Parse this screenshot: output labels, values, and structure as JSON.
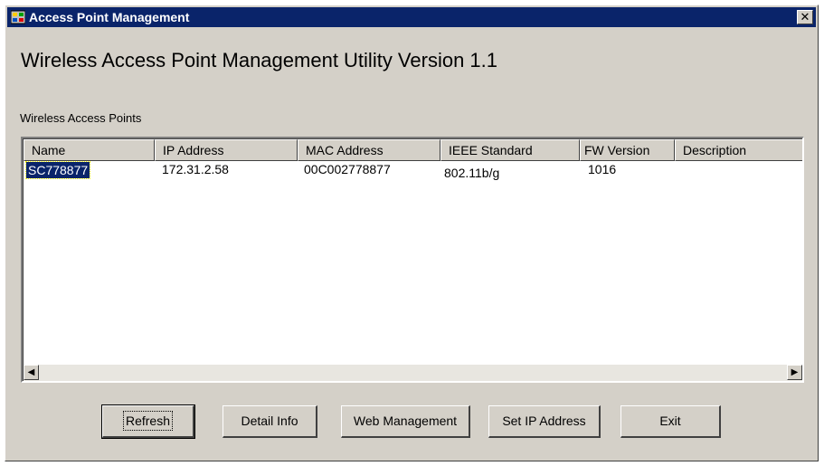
{
  "window": {
    "title": "Access Point Management",
    "close_glyph": "✕"
  },
  "heading": "Wireless Access Point Management Utility Version 1.1",
  "group_label": "Wireless Access Points",
  "table": {
    "columns": [
      "Name",
      "IP Address",
      "MAC Address",
      "IEEE Standard",
      "FW Version",
      "Description"
    ],
    "rows": [
      [
        "SC778877",
        "172.31.2.58",
        "00C002778877",
        "802.11b/g",
        "1016",
        ""
      ]
    ]
  },
  "scrollbar": {
    "left_arrow": "◀",
    "right_arrow": "▶"
  },
  "buttons": {
    "refresh": "Refresh",
    "detail_info": "Detail Info",
    "web_management": "Web Management",
    "set_ip_address": "Set IP Address",
    "exit": "Exit"
  },
  "icons": {
    "app": "app-icon",
    "close": "close-icon"
  }
}
